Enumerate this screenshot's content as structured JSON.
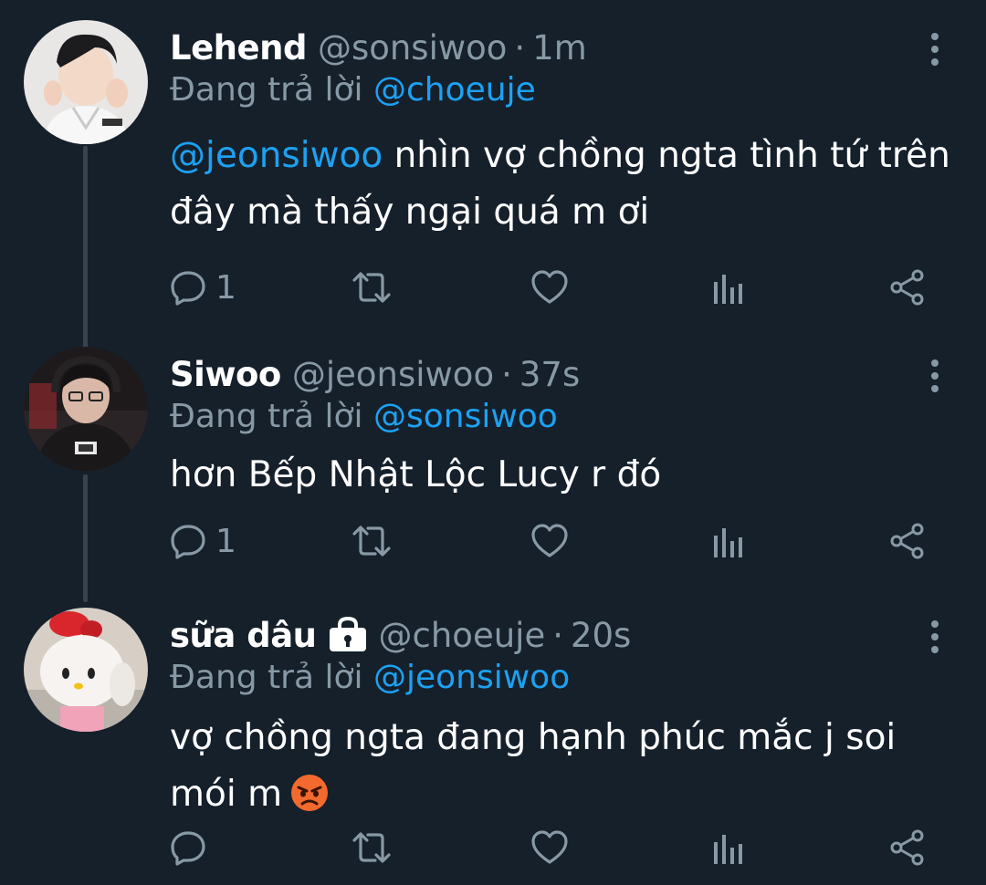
{
  "theme": {
    "background": "#15202b",
    "text_primary": "#ffffff",
    "text_secondary": "#8899a6",
    "accent": "#1da1f2",
    "thread_line": "#38444d"
  },
  "icons": {
    "reply": "reply-icon",
    "retweet": "retweet-icon",
    "like": "heart-icon",
    "analytics": "analytics-icon",
    "share": "share-icon",
    "more": "more-vertical-icon",
    "protected": "lock-icon",
    "emoji": "angry-face-emoji"
  },
  "tweets": [
    {
      "display_name": "Lehend",
      "handle": "@sonsiwoo",
      "separator": "·",
      "time": "1m",
      "reply_prefix": "Đang trả lời",
      "reply_to": "@choeuje",
      "body_mention": "@jeonsiwoo",
      "body_text": " nhìn vợ chồng ngta tình tứ trên đây mà thấy ngại quá m ơi",
      "reply_count": "1",
      "protected": false
    },
    {
      "display_name": "Siwoo",
      "handle": "@jeonsiwoo",
      "separator": "·",
      "time": "37s",
      "reply_prefix": "Đang trả lời",
      "reply_to": "@sonsiwoo",
      "body_mention": "",
      "body_text": "hơn Bếp Nhật Lộc Lucy r đó",
      "reply_count": "1",
      "protected": false
    },
    {
      "display_name": "sữa dâu",
      "handle": "@choeuje",
      "separator": "·",
      "time": "20s",
      "reply_prefix": "Đang trả lời",
      "reply_to": "@jeonsiwoo",
      "body_mention": "",
      "body_text": "vợ chồng ngta đang hạnh phúc mắc j soi mói m",
      "reply_count": "",
      "protected": true
    }
  ]
}
